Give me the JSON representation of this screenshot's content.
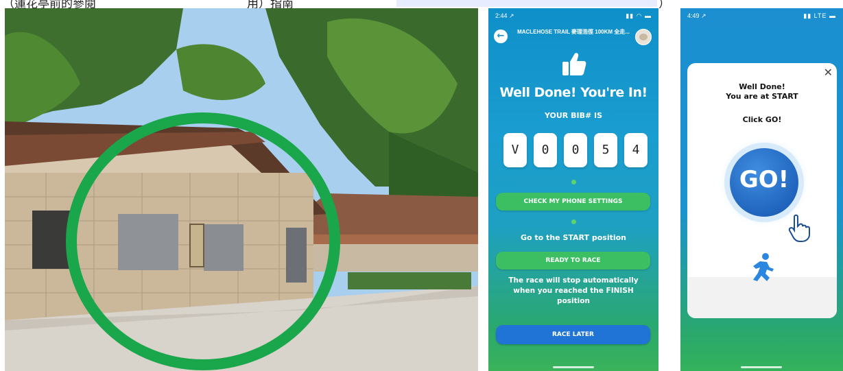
{
  "caption": {
    "text": "（蓮花亭前的參閱",
    "middle": "用）指南",
    "end": "）"
  },
  "phone_go_to_start": {
    "status_time": "2:44 ↗",
    "status_icons": "▮▮ ◠ ▬",
    "header_title": "MACLEHOSE TRAIL 麥理浩徑 100KM 全走...",
    "back_icon": "arrow-left",
    "headline": "Well Done! You're In!",
    "bib_label": "YOUR BIB# IS",
    "bib_digits": [
      "V",
      "0",
      "0",
      "5",
      "4"
    ],
    "check_settings_button": "CHECK MY PHONE SETTINGS",
    "go_to_start_text": "Go to the START position",
    "ready_button": "READY TO RACE",
    "auto_stop_text": "The race will stop automatically when you reached the FINISH position",
    "race_later_button": "RACE LATER",
    "colors": {
      "green_button": "#3cbf63",
      "blue_button": "#1f74d6"
    }
  },
  "phone_start": {
    "status_time": "4:49 ↗",
    "status_icons": "▮▮ LTE ▬",
    "close_icon": "close-x",
    "title_line1": "Well Done!",
    "title_line2": "You are at START",
    "click_text": "Click GO!",
    "go_button": "GO!",
    "go_color": "#1e6fcf"
  },
  "photo": {
    "subject": "stone-building-pavilion",
    "highlight_color": "#1aa64a"
  }
}
